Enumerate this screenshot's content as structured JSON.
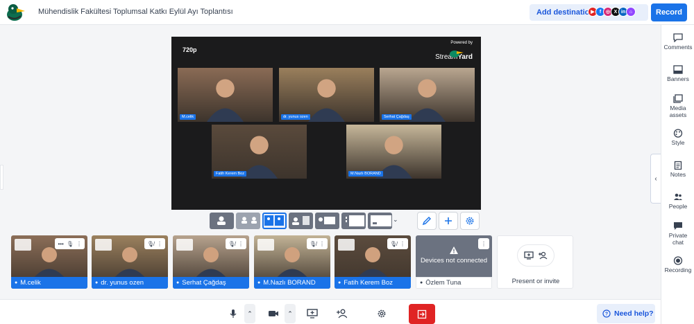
{
  "header": {
    "title": "Mühendislik Fakültesi Toplumsal Katkı Eylül Ayı Toplantısı",
    "add_destination_label": "Add destination",
    "record_label": "Record",
    "destination_icons": [
      {
        "name": "youtube-icon",
        "color": "#e02424",
        "glyph": "▶"
      },
      {
        "name": "facebook-icon",
        "color": "#1877f2",
        "glyph": "f"
      },
      {
        "name": "instagram-icon",
        "color": "#d62976",
        "glyph": "◎"
      },
      {
        "name": "x-icon",
        "color": "#111111",
        "glyph": "X"
      },
      {
        "name": "linkedin-icon",
        "color": "#0a66c2",
        "glyph": "in"
      },
      {
        "name": "twitch-icon",
        "color": "#9146ff",
        "glyph": "⌂"
      }
    ]
  },
  "sidebar": {
    "items": [
      {
        "label": "Comments",
        "icon": "comment-icon"
      },
      {
        "label": "Banners",
        "icon": "banner-icon"
      },
      {
        "label": "Media assets",
        "icon": "media-icon"
      },
      {
        "label": "Style",
        "icon": "palette-icon"
      },
      {
        "label": "Notes",
        "icon": "notes-icon"
      },
      {
        "label": "People",
        "icon": "people-icon"
      },
      {
        "label": "Private chat",
        "icon": "chat-icon"
      },
      {
        "label": "Recording",
        "icon": "record-icon"
      }
    ]
  },
  "stage": {
    "resolution": "720p",
    "powered_by": "Powered by",
    "brand_a": "Stream",
    "brand_b": "Yard",
    "videos": [
      {
        "name": "M.celik",
        "bg": "#8a6b55"
      },
      {
        "name": "dr. yunus ozen",
        "bg": "#9a7f5c"
      },
      {
        "name": "Serhat Çağdaş",
        "bg": "#b9a690"
      },
      {
        "name": "Fatih Kerem Boz",
        "bg": "#5a4a3c"
      },
      {
        "name": "M.Nazlı BORAND",
        "bg": "#c6b79a"
      }
    ]
  },
  "participants": [
    {
      "name": "M.celik",
      "bg": "#8c6e58"
    },
    {
      "name": "dr. yunus ozen",
      "bg": "#9b815e"
    },
    {
      "name": "Serhat Çağdaş",
      "bg": "#b7a38e"
    },
    {
      "name": "M.Nazlı BORAND",
      "bg": "#c2b396"
    },
    {
      "name": "Fatih Kerem Boz",
      "bg": "#5c4c3e"
    }
  ],
  "not_connected": {
    "status": "Devices not connected",
    "name": "Özlem Tuna"
  },
  "invite": {
    "label": "Present or invite"
  },
  "help": {
    "label": "Need help?"
  },
  "colors": {
    "accent": "#1a73e8",
    "leave": "#e02424"
  }
}
